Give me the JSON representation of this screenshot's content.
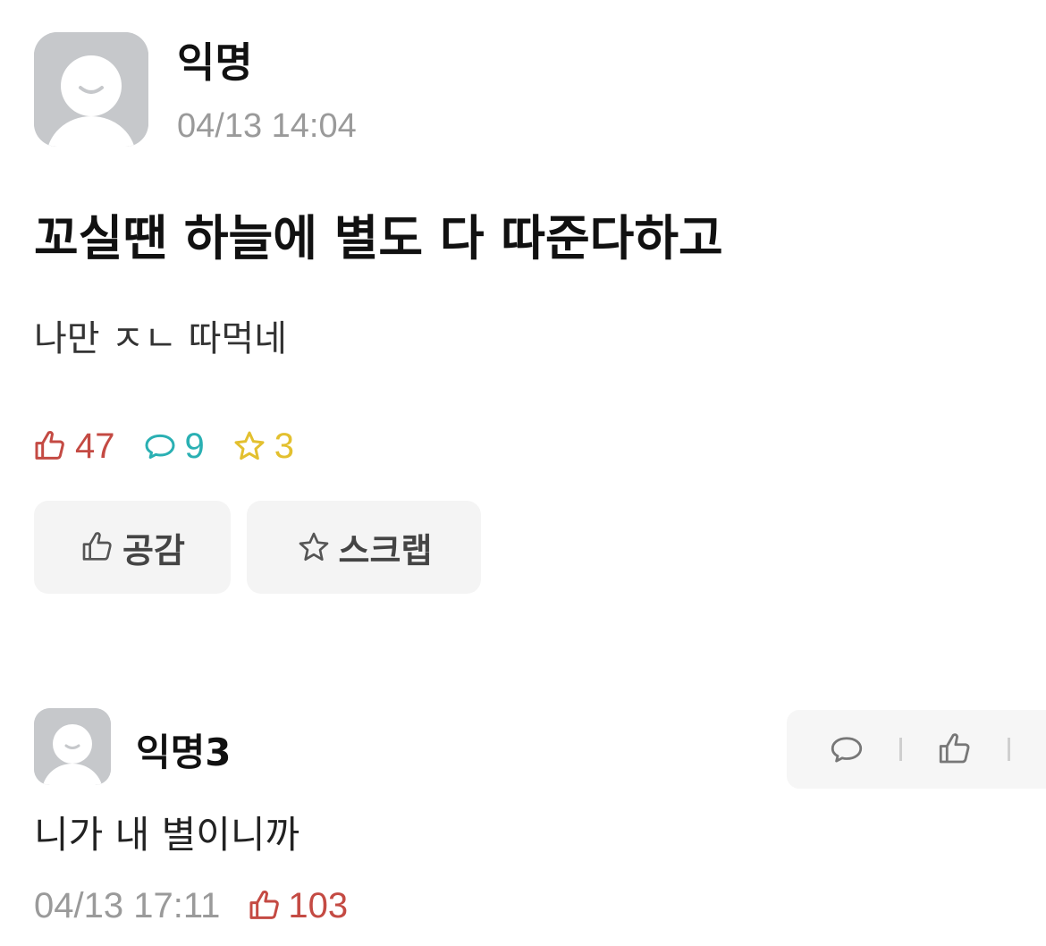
{
  "post": {
    "author": "익명",
    "time": "04/13 14:04",
    "title": "꼬실땐 하늘에 별도 다 따준다하고",
    "body": "나만 ㅈㄴ 따먹네",
    "stats": {
      "likes": "47",
      "comments": "9",
      "scraps": "3"
    },
    "colors": {
      "like": "#c44a43",
      "comment": "#2ab0b3",
      "scrap": "#e3c02f"
    },
    "buttons": {
      "empathy_label": "공감",
      "scrap_label": "스크랩"
    }
  },
  "comment": {
    "author": "익명3",
    "body": "니가 내 별이니까",
    "time": "04/13 17:11",
    "likes": "103"
  },
  "icons": [
    "avatar-placeholder-icon",
    "thumbs-up-icon",
    "speech-bubble-icon",
    "star-icon"
  ]
}
